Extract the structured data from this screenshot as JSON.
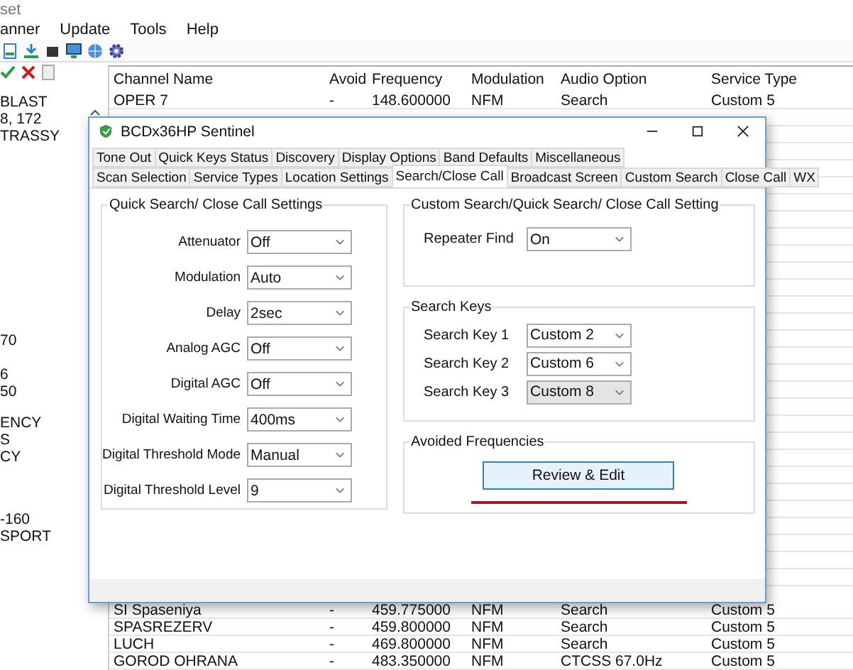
{
  "app": {
    "title": "set",
    "menu": [
      "anner",
      "Update",
      "Tools",
      "Help"
    ]
  },
  "tree": {
    "groups": [
      [
        "BLAST",
        "8, 172",
        "TRASSY"
      ],
      [
        "70"
      ],
      [
        "6",
        "50"
      ],
      [
        "ENCY",
        "S",
        "CY"
      ],
      [
        "-160",
        "SPORT"
      ]
    ]
  },
  "table": {
    "columns": [
      "Channel Name",
      "Avoid",
      "Frequency",
      "Modulation",
      "Audio Option",
      "Service Type"
    ],
    "rows": [
      [
        "OPER 7",
        "-",
        "148.600000",
        "NFM",
        "Search",
        "Custom 5"
      ],
      [
        "SI Spaseniya",
        "-",
        "459.775000",
        "NFM",
        "Search",
        "Custom 5"
      ],
      [
        "SPASREZERV",
        "-",
        "459.800000",
        "NFM",
        "Search",
        "Custom 5"
      ],
      [
        "LUCH",
        "-",
        "469.800000",
        "NFM",
        "Search",
        "Custom 5"
      ],
      [
        "GOROD OHRANA",
        "-",
        "483.350000",
        "NFM",
        "CTCSS 67.0Hz",
        "Custom 5"
      ]
    ]
  },
  "dialog": {
    "title": "BCDx36HP Sentinel",
    "tab_rows": [
      [
        {
          "label": "Tone Out",
          "selected": false
        },
        {
          "label": "Quick Keys Status",
          "selected": false
        },
        {
          "label": "Discovery",
          "selected": false
        },
        {
          "label": "Display Options",
          "selected": false
        },
        {
          "label": "Band Defaults",
          "selected": false
        },
        {
          "label": "Miscellaneous",
          "selected": false
        }
      ],
      [
        {
          "label": "Scan Selection",
          "selected": false
        },
        {
          "label": "Service Types",
          "selected": false
        },
        {
          "label": "Location Settings",
          "selected": false
        },
        {
          "label": "Search/Close Call",
          "selected": true
        },
        {
          "label": "Broadcast Screen",
          "selected": false
        },
        {
          "label": "Custom Search",
          "selected": false
        },
        {
          "label": "Close Call",
          "selected": false
        },
        {
          "label": "WX",
          "selected": false
        }
      ]
    ],
    "quick_settings": {
      "title": "Quick Search/ Close Call Settings",
      "fields": [
        {
          "label": "Attenuator",
          "value": "Off"
        },
        {
          "label": "Modulation",
          "value": "Auto"
        },
        {
          "label": "Delay",
          "value": "2sec"
        },
        {
          "label": "Analog AGC",
          "value": "Off"
        },
        {
          "label": "Digital AGC",
          "value": "Off"
        },
        {
          "label": "Digital Waiting Time",
          "value": "400ms"
        },
        {
          "label": "Digital Threshold Mode",
          "value": "Manual"
        },
        {
          "label": "Digital Threshold Level",
          "value": "9"
        }
      ]
    },
    "custom_settings": {
      "title": "Custom Search/Quick Search/ Close Call Setting",
      "fields": [
        {
          "label": "Repeater Find",
          "value": "On"
        }
      ]
    },
    "search_keys": {
      "title": "Search Keys",
      "fields": [
        {
          "label": "Search Key 1",
          "value": "Custom 2",
          "disabled": false
        },
        {
          "label": "Search Key 2",
          "value": "Custom 6",
          "disabled": false
        },
        {
          "label": "Search Key 3",
          "value": "Custom 8",
          "disabled": true
        }
      ]
    },
    "avoided": {
      "title": "Avoided Frequencies",
      "button": "Review & Edit"
    }
  }
}
